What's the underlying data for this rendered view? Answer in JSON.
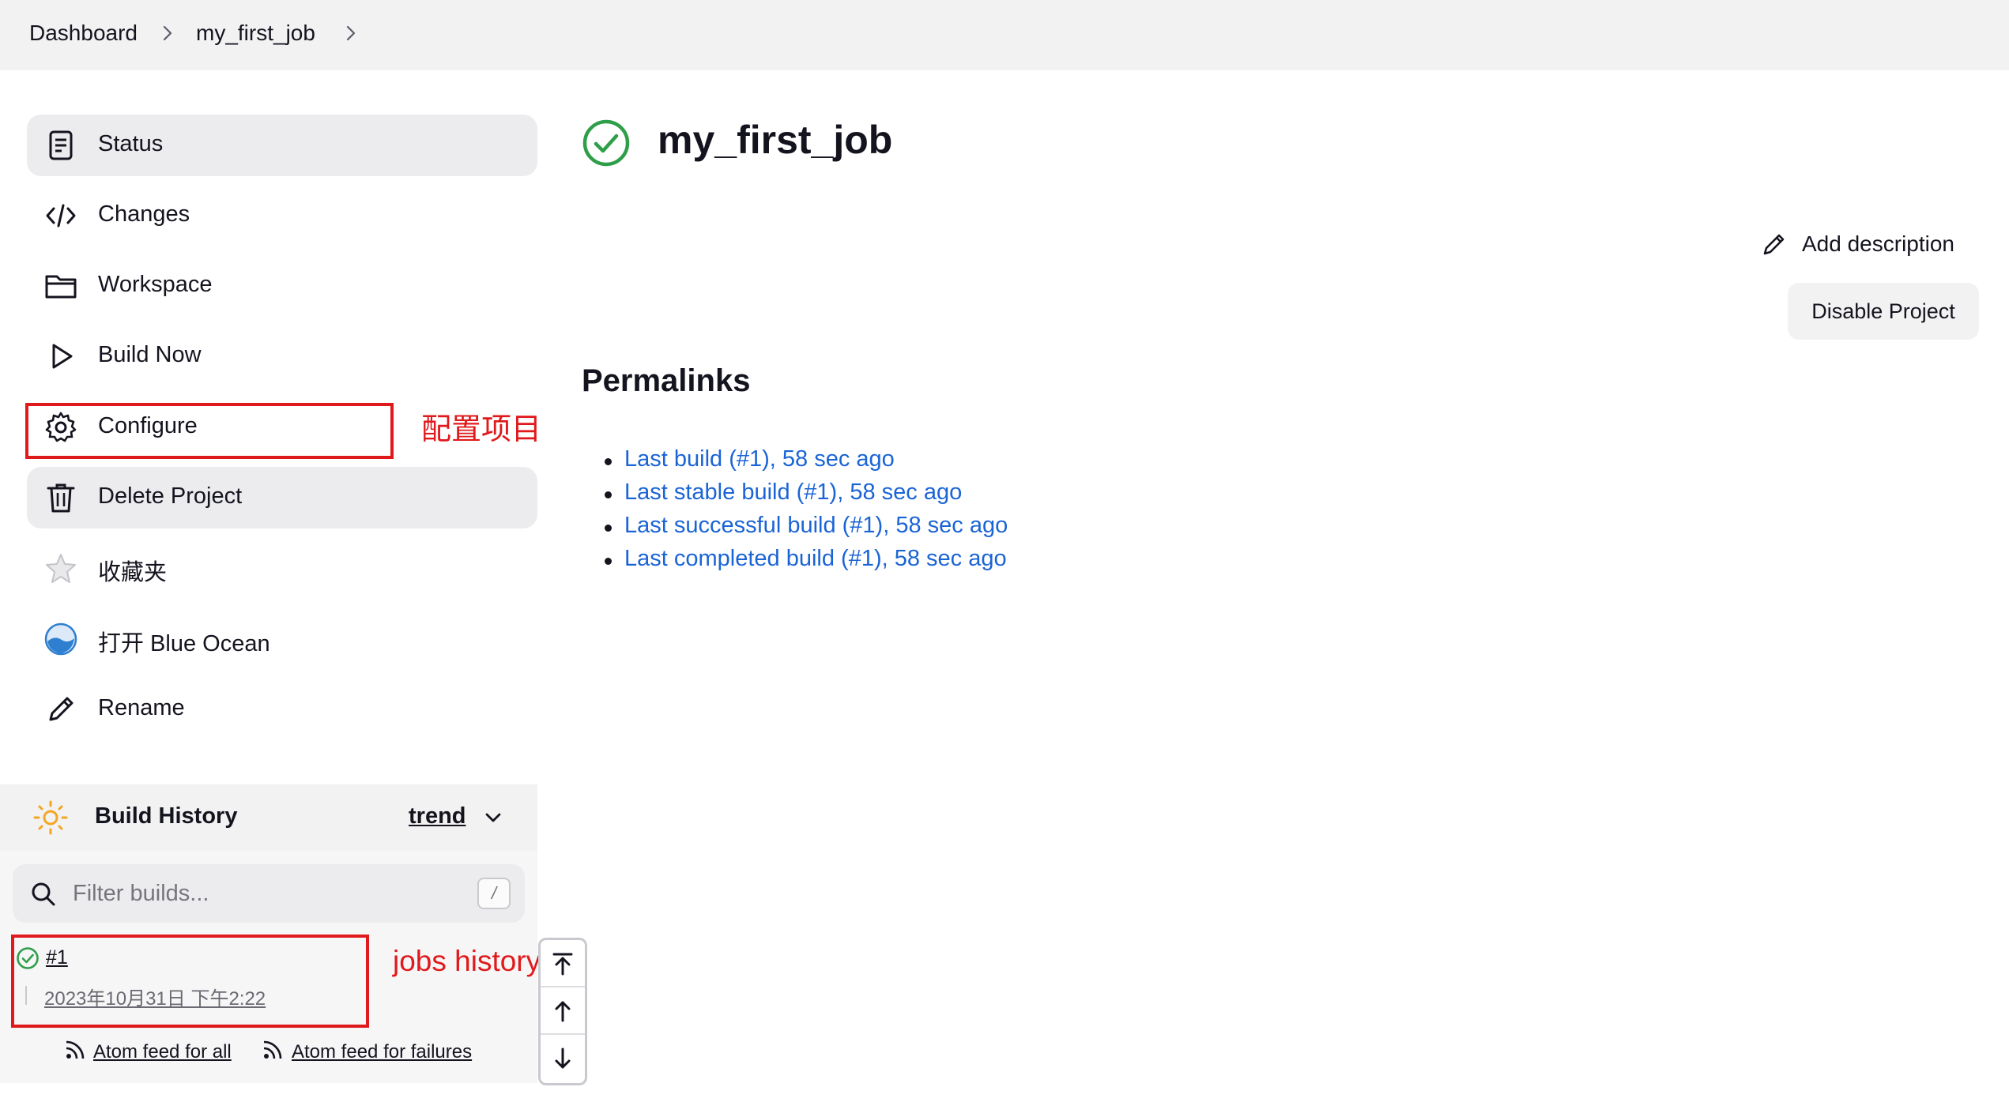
{
  "breadcrumb": {
    "items": [
      "Dashboard",
      "my_first_job"
    ]
  },
  "sidebar": {
    "items": [
      {
        "label": "Status",
        "icon": "document-icon"
      },
      {
        "label": "Changes",
        "icon": "code-icon"
      },
      {
        "label": "Workspace",
        "icon": "folder-icon"
      },
      {
        "label": "Build Now",
        "icon": "play-icon"
      },
      {
        "label": "Configure",
        "icon": "gear-icon"
      },
      {
        "label": "Delete Project",
        "icon": "trash-icon"
      },
      {
        "label": "收藏夹",
        "icon": "star-icon"
      },
      {
        "label": "打开 Blue Ocean",
        "icon": "blue-ocean-icon"
      },
      {
        "label": "Rename",
        "icon": "pencil-icon"
      }
    ]
  },
  "annotations": {
    "configure_note": "配置项目",
    "history_note": "jobs history",
    "color": "#e0191c"
  },
  "build_history": {
    "title": "Build History",
    "trend_label": "trend",
    "filter_placeholder": "Filter builds...",
    "filter_shortcut": "/",
    "builds": [
      {
        "number": "#1",
        "date": "2023年10月31日 下午2:22",
        "status": "success"
      }
    ],
    "feed_all": "Atom feed for all",
    "feed_failures": "Atom feed for failures"
  },
  "main": {
    "title": "my_first_job",
    "status": "success",
    "status_color": "#2e9e49",
    "add_description_label": "Add description",
    "disable_button_label": "Disable Project",
    "permalinks_heading": "Permalinks",
    "permalinks": [
      "Last build (#1), 58 sec ago",
      "Last stable build (#1), 58 sec ago",
      "Last successful build (#1), 58 sec ago",
      "Last completed build (#1), 58 sec ago"
    ],
    "link_color": "#1a64d6"
  }
}
